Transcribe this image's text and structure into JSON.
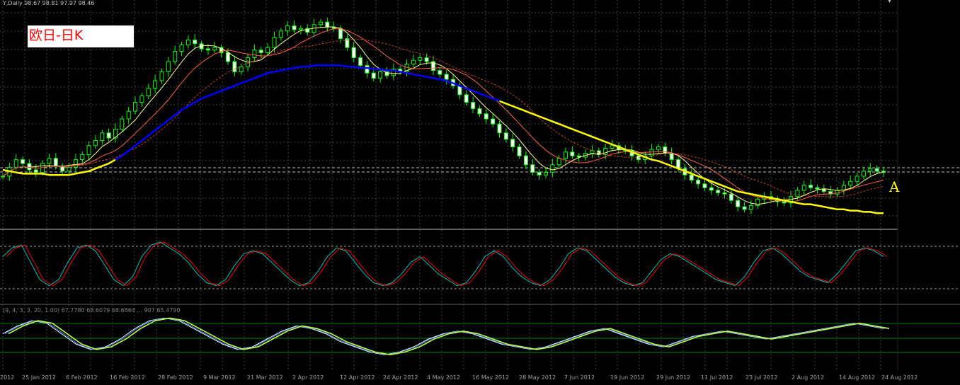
{
  "header": {
    "ohlc_text": "Y,Daily  98.67 98.81 97.97 98.46",
    "stoch1_label": "",
    "stoch2_label": "(9, 4, 3, 3, 20, 1.00) 67.7780 68.6079 68.6864 ... 907 65.4790"
  },
  "title": "欧日-日K",
  "annotation": "A",
  "colors": {
    "bull": "#00ff00",
    "bear": "#ffffff",
    "ma_yellow": "#ffff00",
    "ma_blue": "#0000ff",
    "ma_pale": "#ffff80",
    "ma_red": "#ff6040",
    "ma_brown": "#c04020",
    "stoch_main": "#00c0c0",
    "stoch_signal": "#ff0000",
    "grid": "#404040"
  },
  "x_axis": {
    "dates": [
      "2012",
      "25 Jan 2012",
      "6 Feb 2012",
      "16 Feb 2012",
      "28 Feb 2012",
      "9 Mar 2012",
      "21 Mar 2012",
      "2 Apr 2012",
      "12 Apr 2012",
      "24 Apr 2012",
      "4 May 2012",
      "16 May 2012",
      "28 May 2012",
      "7 Jun 2012",
      "19 Jun 2012",
      "29 Jun 2012",
      "11 Jul 2012",
      "23 Jul 2012",
      "2 Aug 2012",
      "14 Aug 2012",
      "24 Aug 2012"
    ]
  },
  "chart_data": [
    {
      "type": "line",
      "series": [
        {
          "values": [
            100.5,
            101.2,
            101.8,
            101.5,
            101.0,
            100.8,
            101.5,
            101.9,
            101.3,
            100.9,
            101.2,
            101.8,
            102.2,
            102.9,
            103.3,
            103.9,
            103.5,
            104.2,
            105.0,
            105.6,
            106.3,
            106.8,
            107.4,
            108.0,
            108.7,
            109.5,
            110.3,
            110.8,
            111.2,
            110.9,
            110.5,
            110.4,
            110.6,
            110.2,
            109.5,
            108.7,
            109.1,
            109.8,
            110.4,
            110.2,
            110.6,
            111.4,
            111.9,
            112.3,
            112.0,
            112.1,
            111.8,
            112.4,
            112.6,
            112.2,
            112.1,
            111.3,
            110.6,
            109.8,
            109.2,
            108.6,
            108.2,
            108.7,
            108.4,
            108.9,
            108.7,
            109.3,
            109.6,
            109.8,
            109.5,
            108.8,
            108.5,
            108.1,
            107.6,
            106.9,
            106.3,
            105.8,
            105.4,
            105.0,
            104.6,
            103.9,
            103.4,
            102.8,
            102.1,
            101.4,
            100.8,
            100.6,
            100.8,
            101.4,
            101.9,
            102.4,
            102.1,
            102.0,
            102.3,
            102.5,
            102.2,
            102.7,
            102.9,
            102.6,
            102.5,
            102.1,
            101.8,
            102.1,
            102.6,
            102.8,
            102.3,
            101.8,
            101.1,
            100.6,
            100.2,
            99.9,
            99.6,
            99.4,
            99.2,
            99.1,
            98.6,
            98.1,
            97.9,
            98.2,
            98.7,
            98.9,
            98.7,
            98.5,
            98.4,
            98.9,
            99.4,
            99.8,
            99.6,
            99.5,
            99.3,
            99.1,
            99.4,
            99.8,
            100.1,
            100.5,
            100.9,
            101.1,
            100.9,
            100.8
          ]
        },
        {
          "values": [
            101.0,
            100.9,
            100.8,
            100.7,
            100.7,
            100.7,
            100.7,
            100.6,
            100.6,
            100.6,
            100.6,
            100.7,
            100.8,
            100.9,
            101.1,
            101.3,
            101.5,
            101.8,
            102.1,
            102.5,
            102.9,
            103.3,
            103.7,
            104.1,
            104.5,
            104.9,
            105.3,
            105.7,
            106.0,
            106.3,
            106.6,
            106.8,
            107.0,
            107.2,
            107.4,
            107.6,
            107.8,
            108.0,
            108.2,
            108.4,
            108.6,
            108.7,
            108.8,
            108.9,
            109.0,
            109.1,
            109.1,
            109.2,
            109.2,
            109.2,
            109.2,
            109.2,
            109.1,
            109.1,
            109.0,
            109.0,
            108.9,
            108.9,
            108.8,
            108.8,
            108.7,
            108.6,
            108.5,
            108.4,
            108.3,
            108.2,
            108.1,
            108.0,
            107.8,
            107.6,
            107.4,
            107.2,
            107.0,
            106.8,
            106.6,
            106.4,
            106.2,
            106.0,
            105.8,
            105.6,
            105.4,
            105.2,
            105.0,
            104.8,
            104.6,
            104.4,
            104.2,
            104.0,
            103.8,
            103.6,
            103.4,
            103.2,
            103.0,
            102.8,
            102.6,
            102.4,
            102.2,
            102.0,
            101.8,
            101.7,
            101.5,
            101.3,
            101.1,
            100.9,
            100.7,
            100.5,
            100.3,
            100.1,
            99.9,
            99.7,
            99.5,
            99.3,
            99.2,
            99.1,
            99.0,
            98.9,
            98.8,
            98.7,
            98.6,
            98.5,
            98.4,
            98.3,
            98.3,
            98.2,
            98.1,
            98.0,
            97.9,
            97.9,
            97.8,
            97.8,
            97.7,
            97.7,
            97.6,
            97.6
          ],
          "dense": true
        }
      ]
    },
    {
      "type": "line",
      "series": [
        {
          "values": [
            70,
            85,
            90,
            60,
            30,
            20,
            30,
            60,
            85,
            90,
            80,
            55,
            30,
            20,
            35,
            70,
            90,
            95,
            85,
            75,
            60,
            40,
            25,
            20,
            30,
            55,
            75,
            80,
            75,
            60,
            45,
            30,
            20,
            25,
            45,
            70,
            85,
            80,
            60,
            40,
            25,
            20,
            25,
            40,
            60,
            70,
            55,
            40,
            30,
            20,
            25,
            45,
            70,
            80,
            70,
            50,
            35,
            25,
            20,
            30,
            50,
            75,
            85,
            80,
            65,
            50,
            35,
            25,
            20,
            25,
            45,
            65,
            75,
            70,
            60,
            50,
            40,
            30,
            25,
            20,
            35,
            60,
            80,
            85,
            75,
            60,
            45,
            35,
            30,
            25,
            40,
            60,
            80,
            85,
            80,
            70
          ]
        }
      ]
    },
    {
      "type": "line",
      "series": [
        {
          "values": [
            60,
            75,
            85,
            80,
            60,
            40,
            30,
            35,
            50,
            70,
            85,
            90,
            85,
            70,
            55,
            40,
            30,
            35,
            50,
            65,
            75,
            70,
            60,
            45,
            35,
            25,
            20,
            25,
            35,
            50,
            60,
            65,
            60,
            50,
            40,
            35,
            30,
            35,
            45,
            55,
            65,
            70,
            60,
            50,
            40,
            35,
            45,
            55,
            60,
            65,
            60,
            55,
            50,
            55,
            60,
            65,
            70,
            75,
            80,
            75,
            70
          ]
        }
      ]
    }
  ]
}
